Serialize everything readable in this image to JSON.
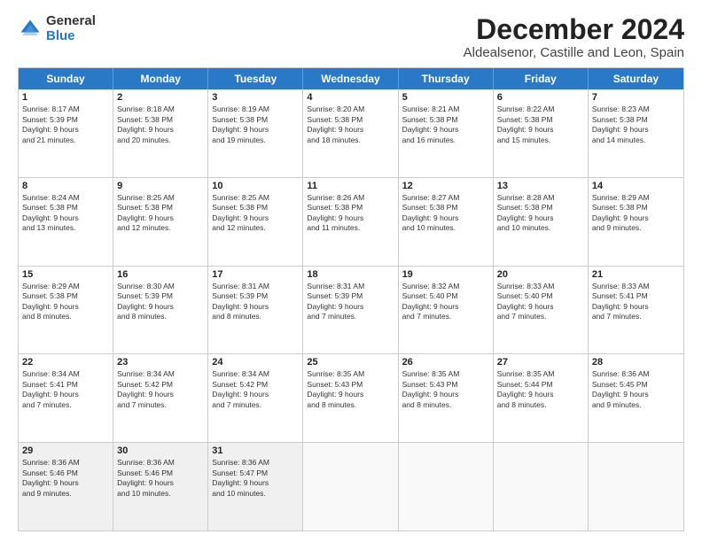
{
  "logo": {
    "general": "General",
    "blue": "Blue"
  },
  "title": "December 2024",
  "subtitle": "Aldealsenor, Castille and Leon, Spain",
  "header_days": [
    "Sunday",
    "Monday",
    "Tuesday",
    "Wednesday",
    "Thursday",
    "Friday",
    "Saturday"
  ],
  "weeks": [
    [
      {
        "day": "1",
        "lines": [
          "Sunrise: 8:17 AM",
          "Sunset: 5:39 PM",
          "Daylight: 9 hours",
          "and 21 minutes."
        ]
      },
      {
        "day": "2",
        "lines": [
          "Sunrise: 8:18 AM",
          "Sunset: 5:38 PM",
          "Daylight: 9 hours",
          "and 20 minutes."
        ]
      },
      {
        "day": "3",
        "lines": [
          "Sunrise: 8:19 AM",
          "Sunset: 5:38 PM",
          "Daylight: 9 hours",
          "and 19 minutes."
        ]
      },
      {
        "day": "4",
        "lines": [
          "Sunrise: 8:20 AM",
          "Sunset: 5:38 PM",
          "Daylight: 9 hours",
          "and 18 minutes."
        ]
      },
      {
        "day": "5",
        "lines": [
          "Sunrise: 8:21 AM",
          "Sunset: 5:38 PM",
          "Daylight: 9 hours",
          "and 16 minutes."
        ]
      },
      {
        "day": "6",
        "lines": [
          "Sunrise: 8:22 AM",
          "Sunset: 5:38 PM",
          "Daylight: 9 hours",
          "and 15 minutes."
        ]
      },
      {
        "day": "7",
        "lines": [
          "Sunrise: 8:23 AM",
          "Sunset: 5:38 PM",
          "Daylight: 9 hours",
          "and 14 minutes."
        ]
      }
    ],
    [
      {
        "day": "8",
        "lines": [
          "Sunrise: 8:24 AM",
          "Sunset: 5:38 PM",
          "Daylight: 9 hours",
          "and 13 minutes."
        ]
      },
      {
        "day": "9",
        "lines": [
          "Sunrise: 8:25 AM",
          "Sunset: 5:38 PM",
          "Daylight: 9 hours",
          "and 12 minutes."
        ]
      },
      {
        "day": "10",
        "lines": [
          "Sunrise: 8:25 AM",
          "Sunset: 5:38 PM",
          "Daylight: 9 hours",
          "and 12 minutes."
        ]
      },
      {
        "day": "11",
        "lines": [
          "Sunrise: 8:26 AM",
          "Sunset: 5:38 PM",
          "Daylight: 9 hours",
          "and 11 minutes."
        ]
      },
      {
        "day": "12",
        "lines": [
          "Sunrise: 8:27 AM",
          "Sunset: 5:38 PM",
          "Daylight: 9 hours",
          "and 10 minutes."
        ]
      },
      {
        "day": "13",
        "lines": [
          "Sunrise: 8:28 AM",
          "Sunset: 5:38 PM",
          "Daylight: 9 hours",
          "and 10 minutes."
        ]
      },
      {
        "day": "14",
        "lines": [
          "Sunrise: 8:29 AM",
          "Sunset: 5:38 PM",
          "Daylight: 9 hours",
          "and 9 minutes."
        ]
      }
    ],
    [
      {
        "day": "15",
        "lines": [
          "Sunrise: 8:29 AM",
          "Sunset: 5:38 PM",
          "Daylight: 9 hours",
          "and 8 minutes."
        ]
      },
      {
        "day": "16",
        "lines": [
          "Sunrise: 8:30 AM",
          "Sunset: 5:39 PM",
          "Daylight: 9 hours",
          "and 8 minutes."
        ]
      },
      {
        "day": "17",
        "lines": [
          "Sunrise: 8:31 AM",
          "Sunset: 5:39 PM",
          "Daylight: 9 hours",
          "and 8 minutes."
        ]
      },
      {
        "day": "18",
        "lines": [
          "Sunrise: 8:31 AM",
          "Sunset: 5:39 PM",
          "Daylight: 9 hours",
          "and 7 minutes."
        ]
      },
      {
        "day": "19",
        "lines": [
          "Sunrise: 8:32 AM",
          "Sunset: 5:40 PM",
          "Daylight: 9 hours",
          "and 7 minutes."
        ]
      },
      {
        "day": "20",
        "lines": [
          "Sunrise: 8:33 AM",
          "Sunset: 5:40 PM",
          "Daylight: 9 hours",
          "and 7 minutes."
        ]
      },
      {
        "day": "21",
        "lines": [
          "Sunrise: 8:33 AM",
          "Sunset: 5:41 PM",
          "Daylight: 9 hours",
          "and 7 minutes."
        ]
      }
    ],
    [
      {
        "day": "22",
        "lines": [
          "Sunrise: 8:34 AM",
          "Sunset: 5:41 PM",
          "Daylight: 9 hours",
          "and 7 minutes."
        ]
      },
      {
        "day": "23",
        "lines": [
          "Sunrise: 8:34 AM",
          "Sunset: 5:42 PM",
          "Daylight: 9 hours",
          "and 7 minutes."
        ]
      },
      {
        "day": "24",
        "lines": [
          "Sunrise: 8:34 AM",
          "Sunset: 5:42 PM",
          "Daylight: 9 hours",
          "and 7 minutes."
        ]
      },
      {
        "day": "25",
        "lines": [
          "Sunrise: 8:35 AM",
          "Sunset: 5:43 PM",
          "Daylight: 9 hours",
          "and 8 minutes."
        ]
      },
      {
        "day": "26",
        "lines": [
          "Sunrise: 8:35 AM",
          "Sunset: 5:43 PM",
          "Daylight: 9 hours",
          "and 8 minutes."
        ]
      },
      {
        "day": "27",
        "lines": [
          "Sunrise: 8:35 AM",
          "Sunset: 5:44 PM",
          "Daylight: 9 hours",
          "and 8 minutes."
        ]
      },
      {
        "day": "28",
        "lines": [
          "Sunrise: 8:36 AM",
          "Sunset: 5:45 PM",
          "Daylight: 9 hours",
          "and 9 minutes."
        ]
      }
    ],
    [
      {
        "day": "29",
        "lines": [
          "Sunrise: 8:36 AM",
          "Sunset: 5:46 PM",
          "Daylight: 9 hours",
          "and 9 minutes."
        ]
      },
      {
        "day": "30",
        "lines": [
          "Sunrise: 8:36 AM",
          "Sunset: 5:46 PM",
          "Daylight: 9 hours",
          "and 10 minutes."
        ]
      },
      {
        "day": "31",
        "lines": [
          "Sunrise: 8:36 AM",
          "Sunset: 5:47 PM",
          "Daylight: 9 hours",
          "and 10 minutes."
        ]
      },
      null,
      null,
      null,
      null
    ]
  ]
}
